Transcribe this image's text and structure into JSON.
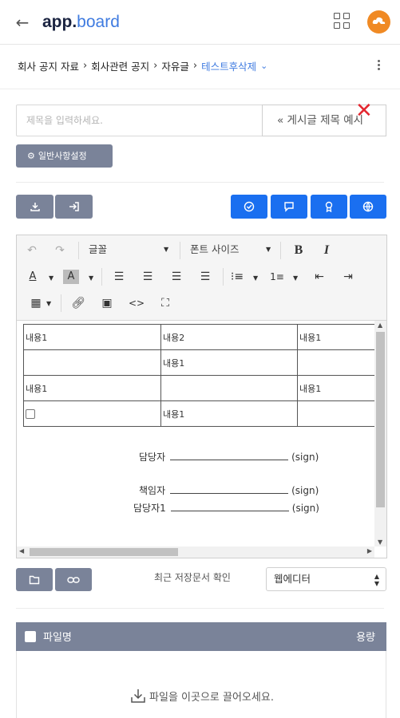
{
  "header": {
    "brand_bold": "app.",
    "brand_light": "board"
  },
  "breadcrumb": {
    "items": [
      "회사 공지 자료",
      "회사관련 공지",
      "자유글",
      "테스트후삭제"
    ]
  },
  "form": {
    "title_placeholder": "제목을 입력하세요.",
    "title_example_button": "« 게시글 제목 예시",
    "settings_button": "일반사항설정"
  },
  "editor": {
    "font_dropdown": "글꼴",
    "size_dropdown": "폰트 사이즈",
    "table": [
      [
        "내용1",
        "내용2",
        "내용1"
      ],
      [
        "",
        "내용1",
        ""
      ],
      [
        "내용1",
        "",
        "내용1"
      ],
      [
        "",
        "내용1",
        ""
      ]
    ],
    "signatures": [
      {
        "label": "담당자",
        "suffix": "(sign)"
      },
      {
        "label": "책임자",
        "suffix": "(sign)"
      },
      {
        "label": "담당자1",
        "suffix": "(sign)"
      }
    ]
  },
  "footer_controls": {
    "recent_label": "최근 저장문서 확인",
    "editor_select": "웹에디터"
  },
  "attachments": {
    "col_name": "파일명",
    "col_size": "용량",
    "drop_message": "파일을 이곳으로 끌어오세요."
  },
  "colors": {
    "accent_blue": "#1a6ff0",
    "gray_button": "#7a8399",
    "avatar_orange": "#f08a24",
    "close_red": "#e3262f"
  }
}
